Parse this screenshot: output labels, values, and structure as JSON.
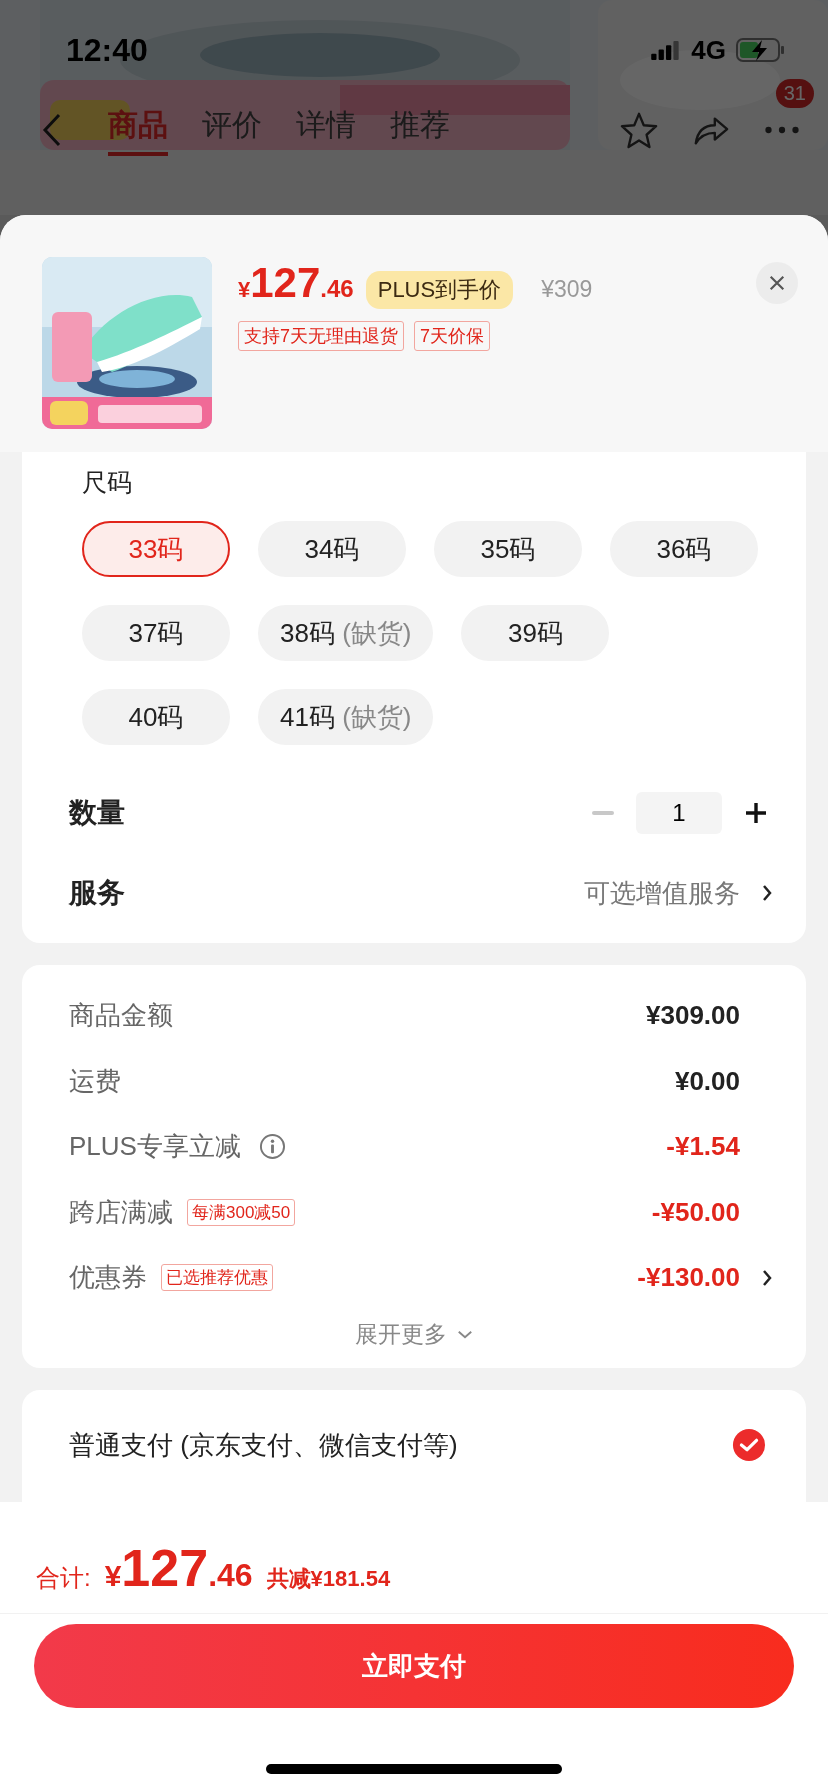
{
  "status_bar": {
    "time": "12:40",
    "network": "4G"
  },
  "nav": {
    "tabs": [
      {
        "label": "商品",
        "selected": true
      },
      {
        "label": "评价",
        "selected": false
      },
      {
        "label": "详情",
        "selected": false
      },
      {
        "label": "推荐",
        "selected": false
      }
    ],
    "badge": "31"
  },
  "product": {
    "price": {
      "symbol": "¥",
      "integer": "127",
      "decimal": ".46"
    },
    "price_badge": "PLUS到手价",
    "original_price": "¥309",
    "tags": [
      "支持7天无理由退货",
      "7天价保"
    ]
  },
  "size": {
    "label": "尺码",
    "options": [
      {
        "label": "33码",
        "selected": true
      },
      {
        "label": "34码",
        "selected": false
      },
      {
        "label": "35码",
        "selected": false
      },
      {
        "label": "36码",
        "selected": false
      },
      {
        "label": "37码",
        "selected": false
      },
      {
        "label": "38码",
        "note": "(缺货)",
        "selected": false
      },
      {
        "label": "39码",
        "selected": false
      },
      {
        "label": "40码",
        "selected": false
      },
      {
        "label": "41码",
        "note": "(缺货)",
        "selected": false
      }
    ]
  },
  "quantity": {
    "label": "数量",
    "value": "1"
  },
  "service": {
    "label": "服务",
    "value": "可选增值服务"
  },
  "summary": {
    "rows": [
      {
        "label": "商品金额",
        "value": "¥309.00",
        "kind": "plain"
      },
      {
        "label": "运费",
        "value": "¥0.00",
        "kind": "plain"
      },
      {
        "label": "PLUS专享立减",
        "value": "-¥1.54",
        "kind": "info"
      },
      {
        "label": "跨店满减",
        "tag": "每满300减50",
        "value": "-¥50.00",
        "kind": "tag"
      },
      {
        "label": "优惠券",
        "tag": "已选推荐优惠",
        "value": "-¥130.00",
        "kind": "link"
      }
    ],
    "expand": "展开更多"
  },
  "payment": {
    "label": "普通支付 (京东支付、微信支付等)",
    "checked": true
  },
  "footer": {
    "total_label": "合计:",
    "total": {
      "symbol": "¥",
      "integer": "127",
      "decimal": ".46"
    },
    "saved": "共减¥181.54",
    "pay_button": "立即支付"
  }
}
